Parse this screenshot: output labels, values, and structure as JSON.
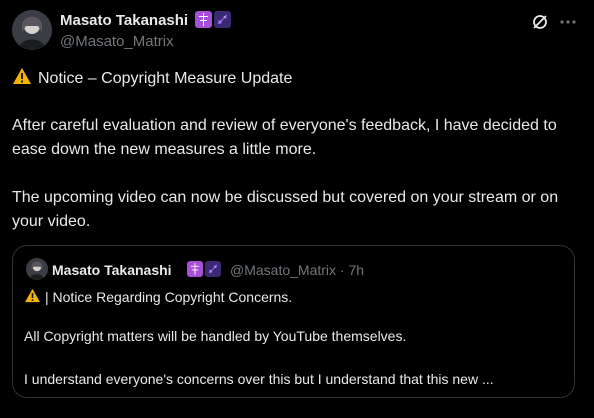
{
  "author": {
    "name": "Masato Takanashi",
    "handle": "@Masato_Matrix",
    "avatar": "avatar-image",
    "badges": [
      "cross-badge-icon",
      "sparkle-badge-icon"
    ]
  },
  "top_actions": {
    "grok_icon": "grok-icon",
    "more_icon": "more-icon"
  },
  "post": {
    "headline_icon": "warning-icon",
    "headline": "Notice – Copyright Measure Update",
    "paragraph1": "After careful evaluation and review of everyone's feedback, I have decided to ease down the new measures a little more.",
    "paragraph2": "The upcoming video can now be discussed but covered on your stream or on your video."
  },
  "quoted_post": {
    "name": "Masato Takanashi",
    "handle_time": "@Masato_Matrix · 7h",
    "title_icon": "warning-icon",
    "title": "| Notice Regarding Copyright Concerns.",
    "line1": "All Copyright matters will be handled by YouTube themselves.",
    "line2": "I understand everyone's concerns over this but I understand that this new ..."
  },
  "colors": {
    "background": "#000000",
    "text": "#e7e9ea",
    "secondary_text": "#71767b",
    "border": "#2f3336",
    "badge_purple": "#a84fd9",
    "badge_dark": "#3b2a73",
    "warning": "#f4b400"
  }
}
